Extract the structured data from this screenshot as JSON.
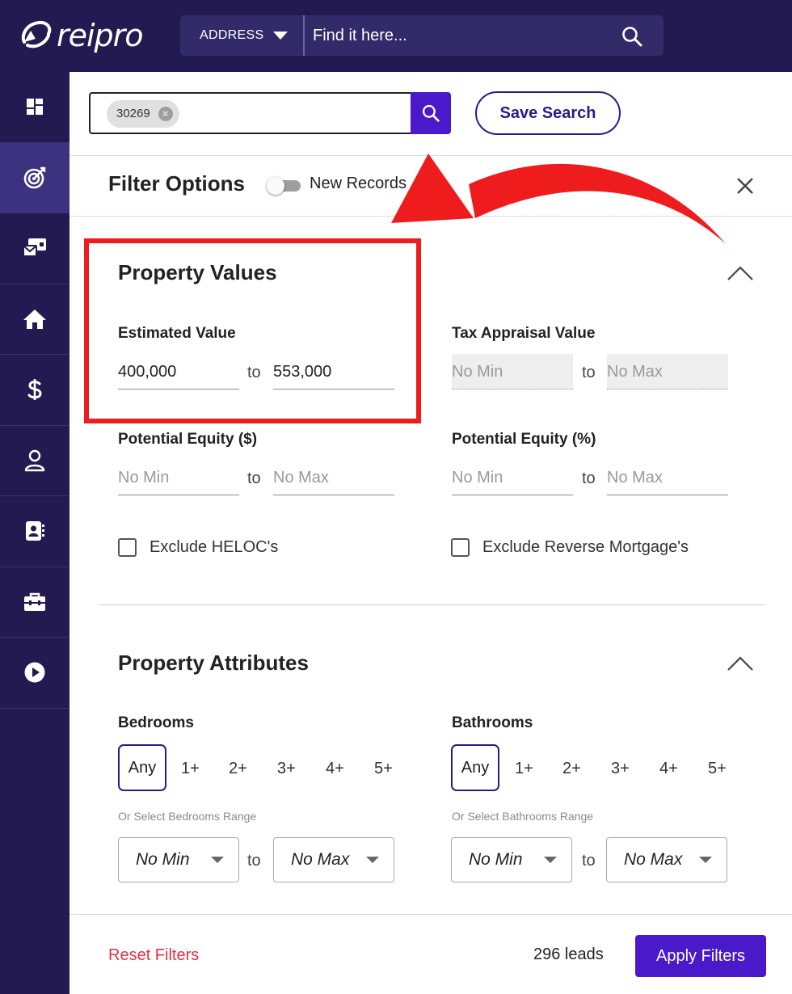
{
  "app": {
    "name": "reipro"
  },
  "topbar": {
    "search_type": "ADDRESS",
    "search_placeholder": "Find it here..."
  },
  "sidebar": {
    "items": [
      {
        "icon": "dashboard-icon"
      },
      {
        "icon": "target-icon",
        "active": true
      },
      {
        "icon": "mail-campaign-icon"
      },
      {
        "icon": "home-icon"
      },
      {
        "icon": "dollar-icon"
      },
      {
        "icon": "user-icon"
      },
      {
        "icon": "contacts-icon"
      },
      {
        "icon": "toolbox-icon"
      },
      {
        "icon": "play-icon"
      }
    ]
  },
  "search": {
    "zip_chip": "30269",
    "save_label": "Save Search"
  },
  "filter": {
    "title": "Filter Options",
    "new_records_label": "New Records",
    "new_records_on": false
  },
  "property_values": {
    "title": "Property Values",
    "estimated": {
      "label": "Estimated Value",
      "min": "400,000",
      "max": "553,000"
    },
    "tax": {
      "label": "Tax Appraisal Value",
      "min_placeholder": "No Min",
      "max_placeholder": "No Max"
    },
    "equity_dollar": {
      "label": "Potential Equity ($)",
      "min_placeholder": "No Min",
      "max_placeholder": "No Max"
    },
    "equity_percent": {
      "label": "Potential Equity (%)",
      "min_placeholder": "No Min",
      "max_placeholder": "No Max"
    },
    "exclude_heloc": "Exclude HELOC's",
    "exclude_reverse": "Exclude Reverse Mortgage's"
  },
  "property_attributes": {
    "title": "Property Attributes",
    "bedrooms": {
      "label": "Bedrooms",
      "options": [
        "Any",
        "1+",
        "2+",
        "3+",
        "4+",
        "5+"
      ],
      "range_hint": "Or Select Bedrooms Range",
      "min": "No Min",
      "max": "No Max"
    },
    "bathrooms": {
      "label": "Bathrooms",
      "options": [
        "Any",
        "1+",
        "2+",
        "3+",
        "4+",
        "5+"
      ],
      "range_hint": "Or Select Bathrooms Range",
      "min": "No Min",
      "max": "No Max"
    }
  },
  "range_separator": "to",
  "footer": {
    "reset_label": "Reset Filters",
    "leads_count": "296 leads",
    "apply_label": "Apply Filters"
  },
  "colors": {
    "nav_bg": "#231a52",
    "accent": "#4a19c9",
    "reset": "#e53241",
    "annotation": "#ee1c1c"
  }
}
